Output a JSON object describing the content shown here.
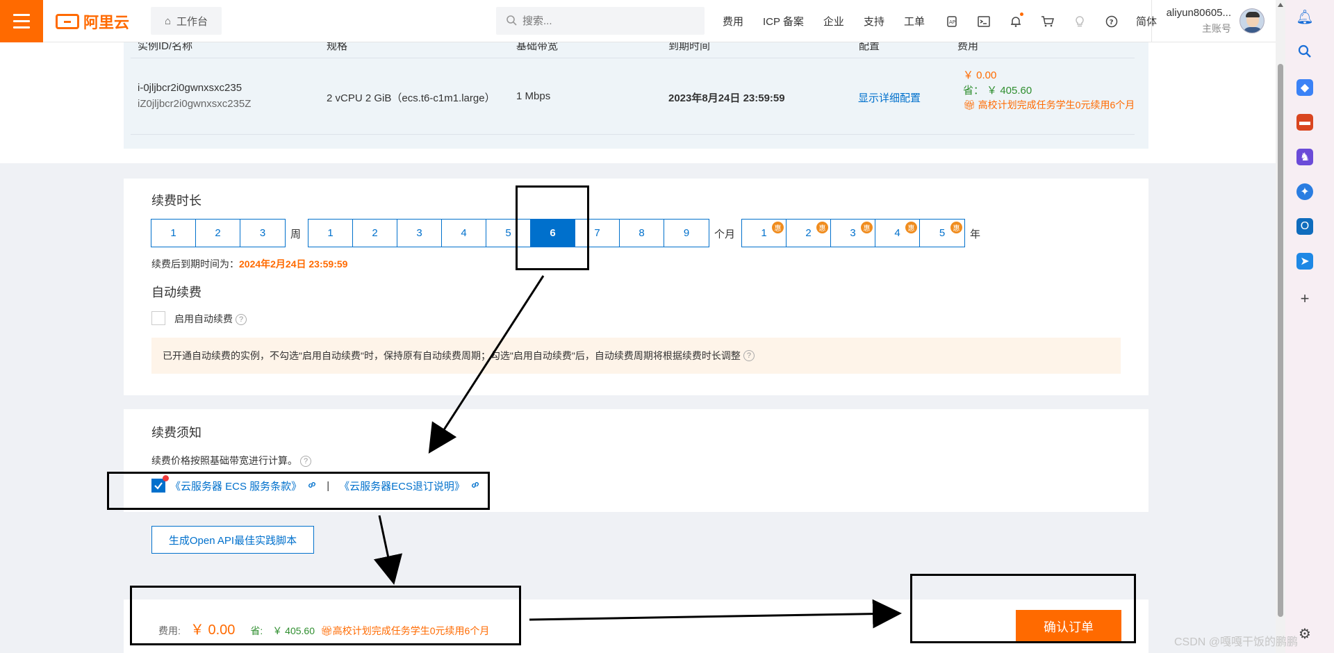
{
  "topbar": {
    "logo_text": "阿里云",
    "workbench": "工作台",
    "search_placeholder": "搜索...",
    "nav": [
      "费用",
      "ICP 备案",
      "企业",
      "支持",
      "工单",
      "简体"
    ],
    "user_name": "aliyun80605...",
    "user_sub": "主账号"
  },
  "instance": {
    "headers": [
      "实例ID/名称",
      "规格",
      "基础带宽",
      "到期时间",
      "配置",
      "费用"
    ],
    "id": "i-0jljbcr2i0gwnxsxc235",
    "name": "iZ0jljbcr2i0gwnxsxc235Z",
    "spec": "2 vCPU 2 GiB（ecs.t6-c1m1.large）",
    "bandwidth": "1 Mbps",
    "expire": "2023年8月24日 23:59:59",
    "config_link": "显示详细配置",
    "price": "￥ 0.00",
    "save": "省： ￥ 405.60",
    "promo": "高校计划完成任务学生0元续用6个月"
  },
  "renew": {
    "title": "续费时长",
    "weeks": [
      "1",
      "2",
      "3"
    ],
    "week_unit": "周",
    "months": [
      "1",
      "2",
      "3",
      "4",
      "5",
      "6",
      "7",
      "8",
      "9"
    ],
    "month_unit": "个月",
    "years": [
      "1",
      "2",
      "3",
      "4",
      "5"
    ],
    "year_unit": "年",
    "discount_badge": "惠",
    "selected_month": "6",
    "expire_label": "续费后到期时间为：",
    "expire_value": "2024年2月24日 23:59:59"
  },
  "auto_renew": {
    "title": "自动续费",
    "checkbox_label": "启用自动续费",
    "notice": "已开通自动续费的实例，不勾选\"启用自动续费\"时，保持原有自动续费周期；勾选\"启用自动续费\"后，自动续费周期将根据续费时长调整"
  },
  "terms": {
    "title": "续费须知",
    "note": "续费价格按照基础带宽进行计算。",
    "link1": "《云服务器 ECS 服务条款》",
    "separator": "|",
    "link2": "《云服务器ECS退订说明》"
  },
  "api_button": "生成Open API最佳实践脚本",
  "footer": {
    "fee_label": "费用:",
    "fee_value": "￥ 0.00",
    "save_label": "省:",
    "save_value": "￥ 405.60",
    "promo": "高校计划完成任务学生0元续用6个月",
    "confirm": "确认订单"
  },
  "watermark": "CSDN @嘎嘎干饭的鹏鹏",
  "colors": {
    "accent": "#ff6a00",
    "link": "#0070cc",
    "save": "#2f8e2f"
  }
}
